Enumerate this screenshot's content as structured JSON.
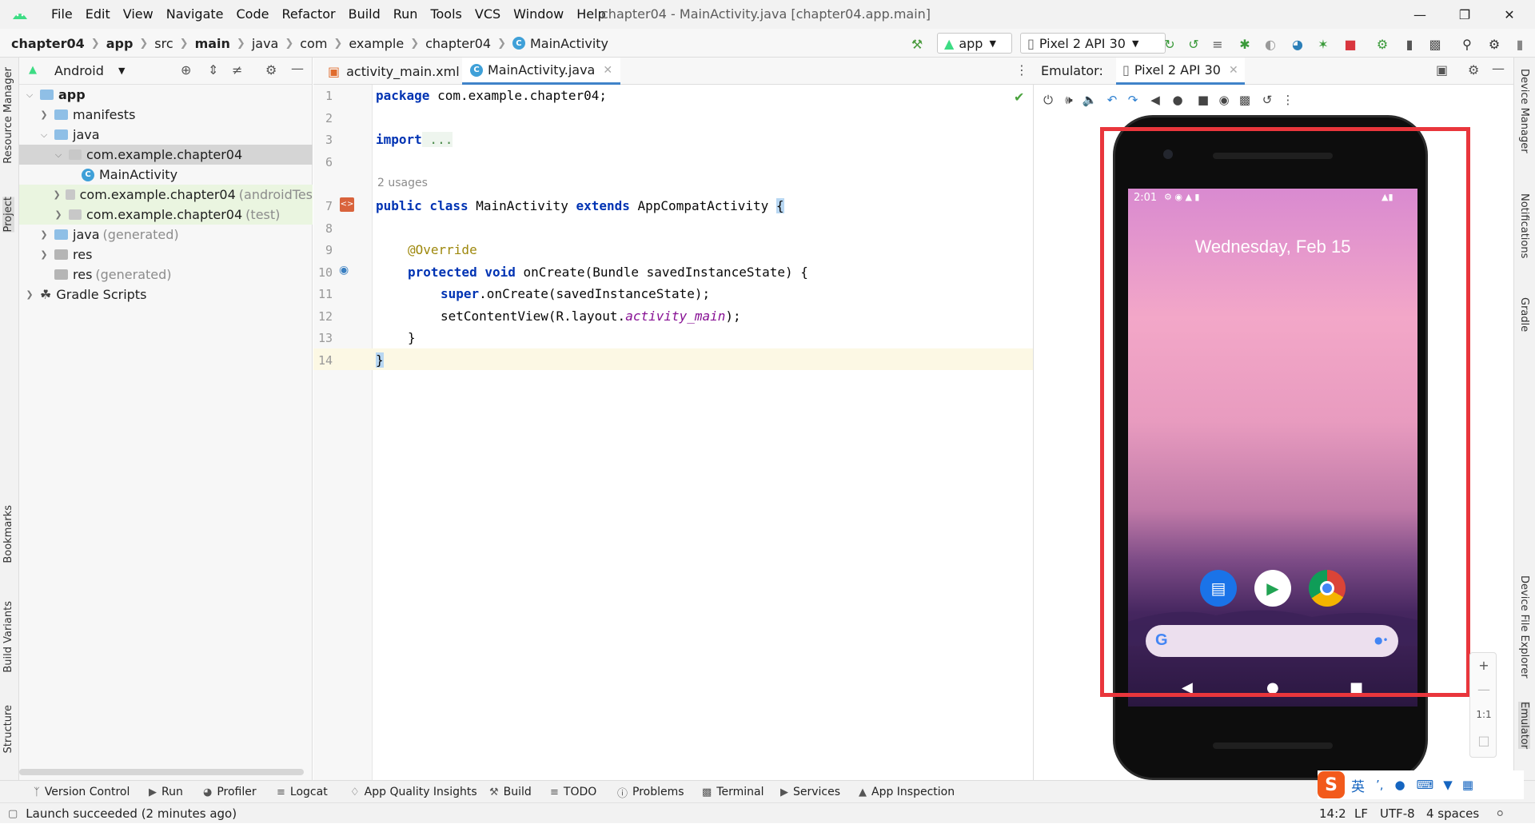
{
  "menubar": {
    "items": [
      "File",
      "Edit",
      "View",
      "Navigate",
      "Code",
      "Refactor",
      "Build",
      "Run",
      "Tools",
      "VCS",
      "Window",
      "Help"
    ],
    "window_title": "chapter04 - MainActivity.java [chapter04.app.main]"
  },
  "breadcrumbs": [
    "chapter04",
    "app",
    "src",
    "main",
    "java",
    "com",
    "example",
    "chapter04",
    "MainActivity"
  ],
  "toolbar": {
    "run_config": "app",
    "device": "Pixel 2 API 30"
  },
  "left_tabs": [
    "Resource Manager",
    "Project",
    "Bookmarks",
    "Build Variants",
    "Structure"
  ],
  "right_tabs": [
    "Device Manager",
    "Notifications",
    "Gradle",
    "Device File Explorer",
    "Emulator"
  ],
  "project": {
    "view": "Android",
    "tree": [
      {
        "label": "app",
        "suffix": ""
      },
      {
        "label": "manifests",
        "suffix": ""
      },
      {
        "label": "java",
        "suffix": ""
      },
      {
        "label": "com.example.chapter04",
        "suffix": ""
      },
      {
        "label": "MainActivity",
        "suffix": ""
      },
      {
        "label": "com.example.chapter04",
        "suffix": "(androidTes"
      },
      {
        "label": "com.example.chapter04",
        "suffix": "(test)"
      },
      {
        "label": "java",
        "suffix": "(generated)"
      },
      {
        "label": "res",
        "suffix": ""
      },
      {
        "label": "res",
        "suffix": "(generated)"
      },
      {
        "label": "Gradle Scripts",
        "suffix": ""
      }
    ]
  },
  "editor": {
    "tabs": [
      "activity_main.xml",
      "MainActivity.java"
    ],
    "line_numbers": [
      "1",
      "2",
      "3",
      "6",
      "7",
      "8",
      "9",
      "10",
      "11",
      "12",
      "13",
      "14"
    ],
    "usages_hint": "2 usages",
    "code": {
      "l1_kw": "package",
      "l1_rest": " com.example.chapter04;",
      "l3_kw": "import",
      "l3_rest": " ...",
      "l7_kw1": "public class",
      "l7_mid": " MainActivity ",
      "l7_kw2": "extends",
      "l7_rest": " AppCompatActivity ",
      "l7_brace": "{",
      "l9_ann": "@Override",
      "l10_kw": "protected void",
      "l10_rest": " onCreate(Bundle savedInstanceState) {",
      "l11_kw": "super",
      "l11_rest": ".onCreate(savedInstanceState);",
      "l12_pre": "setContentView(R.layout.",
      "l12_fld": "activity_main",
      "l12_post": ");",
      "l13": "}",
      "l14_brace": "}"
    }
  },
  "emulator": {
    "label": "Emulator:",
    "tab": "Pixel 2 API 30",
    "time": "2:01",
    "date": "Wednesday, Feb 15",
    "zoom_ratio": "1:1"
  },
  "bottom_tools": [
    "Version Control",
    "Run",
    "Profiler",
    "Logcat",
    "App Quality Insights",
    "Build",
    "TODO",
    "Problems",
    "Terminal",
    "Services",
    "App Inspection"
  ],
  "status": {
    "message": "Launch succeeded (2 minutes ago)",
    "position": "14:2",
    "line_sep": "LF",
    "encoding": "UTF-8",
    "indent": "4 spaces"
  },
  "ime": {
    "lang": "英"
  }
}
